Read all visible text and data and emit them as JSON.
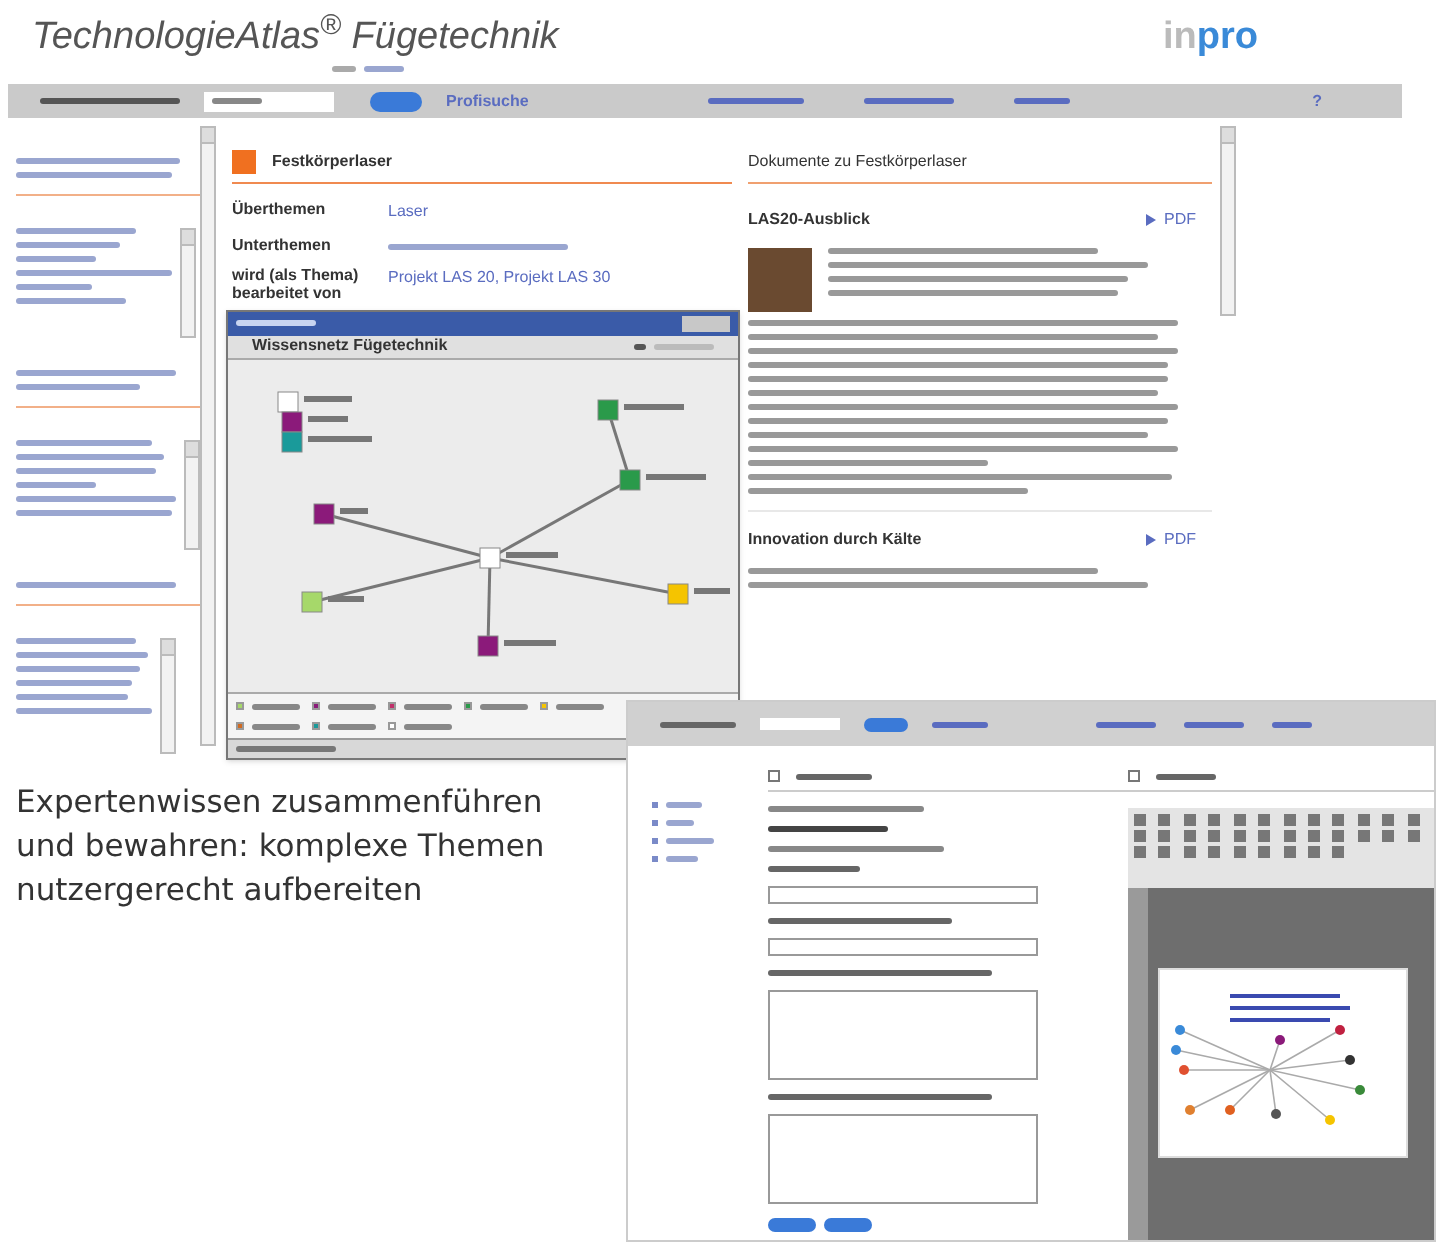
{
  "main_window": {
    "title": "TechnologieAtlas$^{®}$ Fügetechnik",
    "logo": {
      "prefix": "in",
      "name": "pro"
    },
    "nav": {
      "pro_search": "Profisuche",
      "help": "?"
    },
    "topic": {
      "title": "Festkörperlaser",
      "rows": [
        {
          "label": "Überthemen",
          "value": "Laser"
        },
        {
          "label": "Unterthemen"
        },
        {
          "label": "wird (als Thema) bearbeitet von",
          "value": "Projekt LAS 20, Projekt LAS 30"
        }
      ]
    },
    "network_window": {
      "toolbar_title": "Wissensnetz Fügetechnik"
    },
    "documents": {
      "title": "Dokumente zu Festkörperlaser",
      "items": [
        {
          "title": "LAS20-Ausblick",
          "link": "PDF",
          "has_photo": true
        },
        {
          "title": "Innovation durch Kälte",
          "link": "PDF",
          "has_photo": false
        }
      ]
    }
  },
  "caption": "Expertenwissen zusammenführen und bewahren: komplexe Themen nutzergerecht aufbereiten"
}
